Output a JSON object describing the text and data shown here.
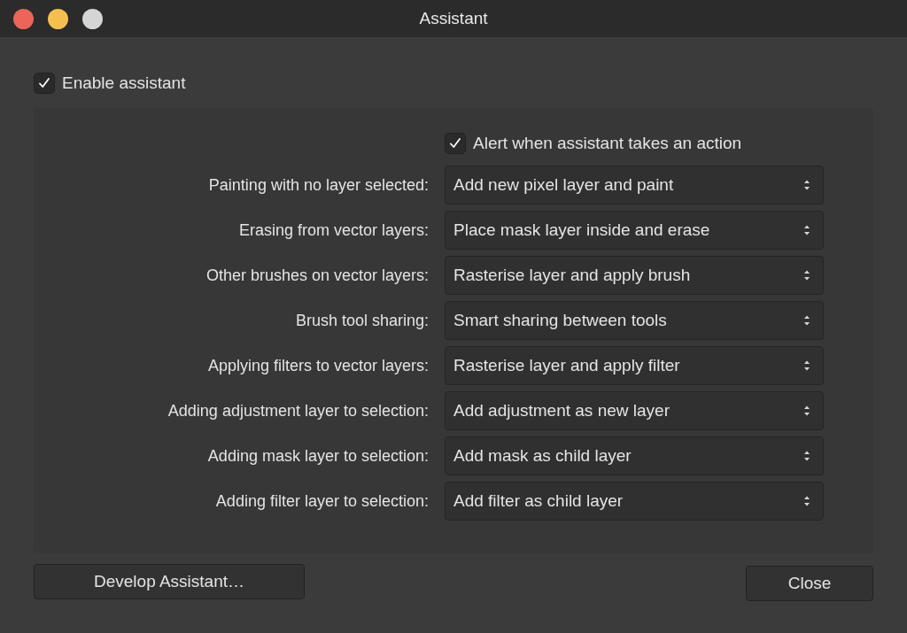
{
  "window": {
    "title": "Assistant"
  },
  "enable_assistant": {
    "label": "Enable assistant",
    "checked": true
  },
  "alert": {
    "label": "Alert when assistant takes an action",
    "checked": true
  },
  "settings": [
    {
      "label": "Painting with no layer selected:",
      "value": "Add new pixel layer and paint"
    },
    {
      "label": "Erasing from vector layers:",
      "value": "Place mask layer inside and erase"
    },
    {
      "label": "Other brushes on vector layers:",
      "value": "Rasterise layer and apply brush"
    },
    {
      "label": "Brush tool sharing:",
      "value": "Smart sharing between tools"
    },
    {
      "label": "Applying filters to vector layers:",
      "value": "Rasterise layer and apply filter"
    },
    {
      "label": "Adding adjustment layer to selection:",
      "value": "Add adjustment as new layer"
    },
    {
      "label": "Adding mask layer to selection:",
      "value": "Add mask as child layer"
    },
    {
      "label": "Adding filter layer to selection:",
      "value": "Add filter as child layer"
    }
  ],
  "buttons": {
    "develop": "Develop Assistant…",
    "close": "Close"
  }
}
